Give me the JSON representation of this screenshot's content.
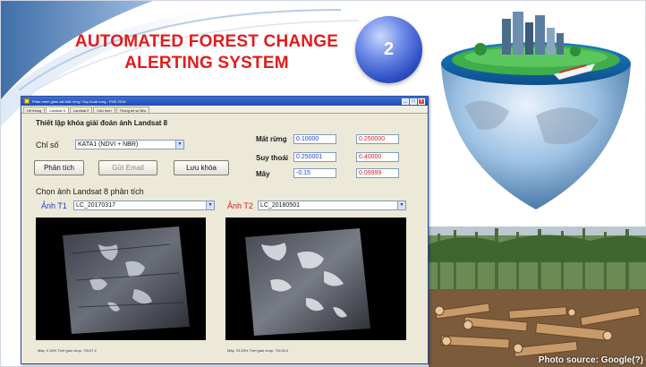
{
  "slide": {
    "title_line1": "AUTOMATED FOREST CHANGE",
    "title_line2": "ALERTING SYSTEM",
    "slide_number": "2",
    "photo_credit": "Photo source: Google(?)"
  },
  "window": {
    "title": "Phần mềm giám sát Mất rừng / Suy thoái rừng - FMS 2018",
    "tabs": [
      "Hệ thống",
      "Landsat 8",
      "Landsat 2",
      "Cấu hình",
      "Thống kê số liệu"
    ],
    "active_tab": "Landsat 8",
    "controls": [
      "_",
      "□",
      "x"
    ]
  },
  "threshold_section": {
    "heading": "Thiết lập khóa giải đoán ảnh Landsat 8",
    "index_label": "Chỉ số",
    "index_value": "KATA1 (NDVI + NBR)",
    "buttons": {
      "analyze": "Phân tích",
      "send_email": "Gửi Email",
      "save_key": "Lưu khóa"
    },
    "rows": [
      {
        "label": "Mất rừng",
        "min": "0.10000",
        "max": "0.250000"
      },
      {
        "label": "Suy thoái",
        "min": "0.250001",
        "max": "0.40000"
      },
      {
        "label": "Mây",
        "min": "-0.15",
        "max": "0.09999"
      }
    ]
  },
  "image_section": {
    "heading": "Chọn ảnh Landsat 8 phân tích",
    "t1_label": "Ảnh T1",
    "t1_value": "LC_20170317",
    "t2_label": "Ảnh T2",
    "t2_value": "LC_20180501",
    "t1_caption": "Mây: 0.16% Thời gian chụp: \"03:07:2",
    "t2_caption": "Mây: 23.83% Thời gian chụp: \"03:06:4"
  },
  "colors": {
    "title_red": "#e31b1b",
    "label_blue": "#1f3fd6",
    "value_red": "#d42020",
    "window_face": "#ece9d8"
  }
}
